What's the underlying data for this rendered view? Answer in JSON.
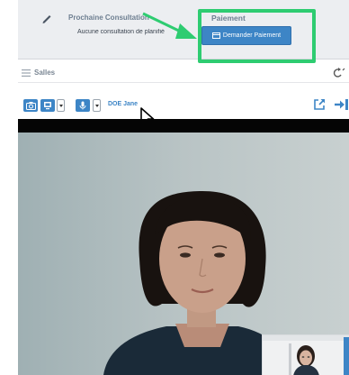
{
  "consultation": {
    "title": "Prochaine Consultation",
    "subtitle": "Aucune consultation de planifié"
  },
  "paiement": {
    "title": "Paiement",
    "button_label": "Demander Paiement"
  },
  "salles": {
    "label": "Salles"
  },
  "toolbar": {
    "participant_name": "DOE Jane"
  },
  "colors": {
    "accent": "#3d85c6",
    "highlight": "#2ecc71",
    "info_bg": "#eceef1"
  },
  "icons": {
    "pencil": "pencil-icon",
    "card": "credit-card-icon",
    "menu": "hamburger-icon",
    "refresh": "refresh-icon",
    "camera": "camera-icon",
    "screen": "screen-share-icon",
    "mic": "microphone-icon",
    "popout": "external-link-icon",
    "exit": "exit-icon"
  }
}
